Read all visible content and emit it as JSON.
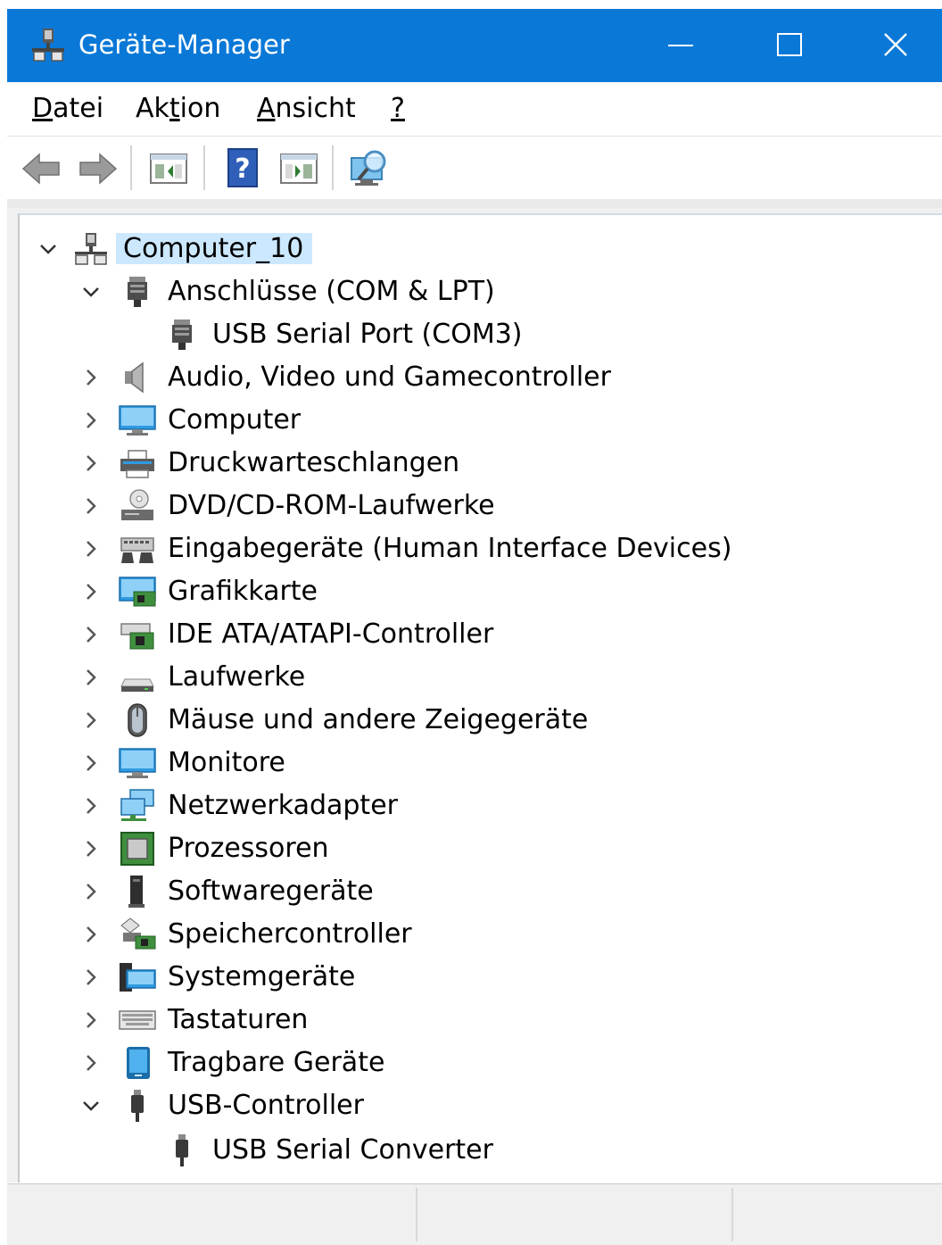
{
  "window": {
    "title": "Geräte-Manager"
  },
  "menu": {
    "items": [
      {
        "pre": "",
        "key": "D",
        "post": "atei"
      },
      {
        "pre": "Ak",
        "key": "t",
        "post": "ion"
      },
      {
        "pre": "",
        "key": "A",
        "post": "nsicht"
      },
      {
        "pre": "",
        "key": "?",
        "post": ""
      }
    ]
  },
  "toolbar": {
    "icons": [
      "back-arrow-icon",
      "forward-arrow-icon",
      "properties-icon",
      "help-icon",
      "update-driver-icon",
      "scan-hardware-icon"
    ]
  },
  "tree": {
    "root": {
      "label": "Computer_10",
      "expanded": true
    },
    "nodes": [
      {
        "label": "Anschlüsse (COM & LPT)",
        "expanded": true,
        "icon": "port-icon",
        "children": [
          {
            "label": "USB Serial Port (COM3)",
            "icon": "port-icon"
          }
        ]
      },
      {
        "label": "Audio, Video und Gamecontroller",
        "expanded": false,
        "icon": "speaker-icon"
      },
      {
        "label": "Computer",
        "expanded": false,
        "icon": "computer-icon"
      },
      {
        "label": "Druckwarteschlangen",
        "expanded": false,
        "icon": "printer-icon"
      },
      {
        "label": "DVD/CD-ROM-Laufwerke",
        "expanded": false,
        "icon": "dvd-drive-icon"
      },
      {
        "label": "Eingabegeräte (Human Interface Devices)",
        "expanded": false,
        "icon": "hid-icon"
      },
      {
        "label": "Grafikkarte",
        "expanded": false,
        "icon": "display-adapter-icon"
      },
      {
        "label": "IDE ATA/ATAPI-Controller",
        "expanded": false,
        "icon": "ide-controller-icon"
      },
      {
        "label": "Laufwerke",
        "expanded": false,
        "icon": "disk-drive-icon"
      },
      {
        "label": "Mäuse und andere Zeigegeräte",
        "expanded": false,
        "icon": "mouse-icon"
      },
      {
        "label": "Monitore",
        "expanded": false,
        "icon": "monitor-icon"
      },
      {
        "label": "Netzwerkadapter",
        "expanded": false,
        "icon": "network-adapter-icon"
      },
      {
        "label": "Prozessoren",
        "expanded": false,
        "icon": "processor-icon"
      },
      {
        "label": "Softwaregeräte",
        "expanded": false,
        "icon": "software-device-icon"
      },
      {
        "label": "Speichercontroller",
        "expanded": false,
        "icon": "storage-controller-icon"
      },
      {
        "label": "Systemgeräte",
        "expanded": false,
        "icon": "system-devices-icon"
      },
      {
        "label": "Tastaturen",
        "expanded": false,
        "icon": "keyboard-icon"
      },
      {
        "label": "Tragbare Geräte",
        "expanded": false,
        "icon": "portable-device-icon"
      },
      {
        "label": "USB-Controller",
        "expanded": true,
        "icon": "usb-icon",
        "children": [
          {
            "label": "USB Serial Converter",
            "icon": "usb-icon"
          }
        ]
      }
    ]
  },
  "colors": {
    "titlebar": "#0a78d7",
    "selection": "#cce8ff",
    "status_bg": "#f0f0f0"
  }
}
